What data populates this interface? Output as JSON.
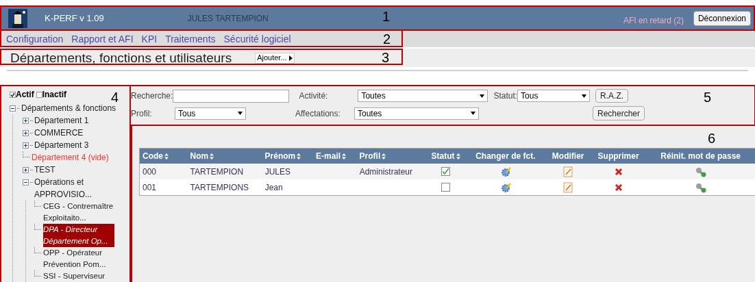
{
  "header": {
    "app_title": "K-PERF v 1.09",
    "user": "JULES TARTEMPION",
    "alert": "AFI en retard (2)",
    "logout": "Déconnexion",
    "callout": "1"
  },
  "menu": {
    "items": [
      "Configuration",
      "Rapport et AFI",
      "KPI",
      "Traitements",
      "Sécurité logiciel"
    ],
    "callout": "2"
  },
  "page_title": {
    "title": "Départements, fonctions et utilisateurs",
    "add_button": "Ajouter...",
    "callout": "3"
  },
  "sidebar": {
    "callout": "4",
    "filters": [
      {
        "label": "Actif",
        "checked": true
      },
      {
        "label": "Inactif",
        "checked": false
      }
    ],
    "tree": [
      {
        "label": "Départements & fonctions",
        "kind": "branch",
        "expanded": true,
        "children": [
          {
            "label": "Département 1",
            "kind": "branch",
            "expanded": false
          },
          {
            "label": "COMMERCE",
            "kind": "branch",
            "expanded": false
          },
          {
            "label": "Département 3",
            "kind": "branch",
            "expanded": false
          },
          {
            "label": "Département 4 (vide)",
            "kind": "empty"
          },
          {
            "label": "TEST",
            "kind": "branch",
            "expanded": false
          },
          {
            "label": "Opérations et APPROVISIO...",
            "kind": "branch",
            "expanded": true,
            "children": [
              {
                "label": "CEG - Contremaître Exploitaito...",
                "kind": "function",
                "selected": false
              },
              {
                "label": "DPA - Directeur Département Op...",
                "kind": "function",
                "selected": true
              },
              {
                "label": "OPP - Opérateur Prévention Pom...",
                "kind": "function",
                "selected": false
              },
              {
                "label": "SSI - Superviseur",
                "kind": "function",
                "selected": false
              }
            ]
          }
        ]
      }
    ]
  },
  "filters": {
    "callout": "5",
    "search_label": "Recherche:",
    "activity_label": "Activité:",
    "activity_value": "Toutes",
    "status_label": "Statut:",
    "status_value": "Tous",
    "reset_button": "R.A.Z.",
    "profile_label": "Profil:",
    "profile_value": "Tous",
    "assignments_label": "Affectations:",
    "assignments_value": "Toutes",
    "search_button": "Rechercher"
  },
  "table": {
    "callout": "6",
    "columns": [
      {
        "label": "Code",
        "sortable": true
      },
      {
        "label": "Nom",
        "sortable": true
      },
      {
        "label": "Prénom",
        "sortable": true
      },
      {
        "label": "E-mail",
        "sortable": true
      },
      {
        "label": "Profil",
        "sortable": true
      },
      {
        "label": "Statut",
        "sortable": true
      },
      {
        "label": "Changer de fct.",
        "sortable": false
      },
      {
        "label": "Modifier",
        "sortable": false
      },
      {
        "label": "Supprimer",
        "sortable": false
      },
      {
        "label": "Réinit. mot de passe",
        "sortable": false
      }
    ],
    "rows": [
      {
        "code": "000",
        "nom": "TARTEMPION",
        "prenom": "JULES",
        "profil": "Administrateur",
        "active": true
      },
      {
        "code": "001",
        "nom": "TARTEMPIONS",
        "prenom": "Jean",
        "active": false
      }
    ]
  }
}
